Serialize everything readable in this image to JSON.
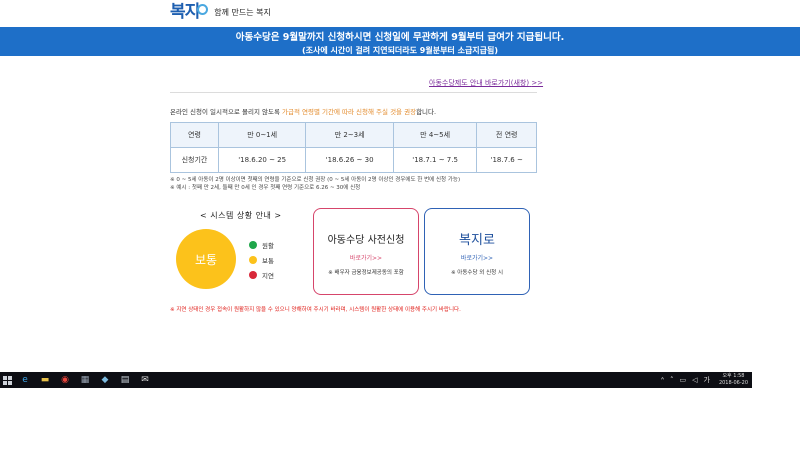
{
  "header": {
    "logo_text": "복지",
    "tagline": "함께 만드는 복지"
  },
  "banner": {
    "line1": "아동수당은 9월말까지 신청하시면 신청일에 무관하게 9월부터 급여가 지급됩니다.",
    "line2": "(조사에 시간이 걸려 지연되더라도 9월분부터 소급지급됨)"
  },
  "info_link": {
    "label": "아동수당제도 안내 바로가기(새창)",
    "arrow": ">>"
  },
  "intro": {
    "before": "온라인 신청이 일시적으로 몰리지 않도록 ",
    "highlight": "가급적 연령별 기간에 따라 신청해 주실 것을 권장",
    "after": "합니다."
  },
  "schedule": {
    "headers": [
      "연령",
      "만 0~1세",
      "만 2~3세",
      "만 4~5세",
      "전 연령"
    ],
    "row": [
      "신청기간",
      "'18.6.20 ~ 25",
      "'18.6.26 ~ 30",
      "'18.7.1 ~ 7.5",
      "'18.7.6 ~"
    ]
  },
  "notes": {
    "line1": "※ 0 ~ 5세 아동이 2명 이상이면 첫째의 연령을 기준으로 신청 권장 (0 ~ 5세 아동이 2명 이상인 경우에도 한 번에 신청 가능)",
    "line2": "※ 예시 : 첫째 만 2세, 둘째 만 0세 인 경우 첫째 연령 기준으로 6.26 ~ 30에 신청"
  },
  "status": {
    "title": "< 시스템 상황 안내 >",
    "current": "보통",
    "legend": [
      {
        "label": "원활",
        "color": "#1fa64a"
      },
      {
        "label": "보통",
        "color": "#fcc21b"
      },
      {
        "label": "지연",
        "color": "#d8283a"
      }
    ]
  },
  "cards": {
    "apply": {
      "title": "아동수당 사전신청",
      "go": "바로가기>>",
      "note": "※ 배우자 금융정보제공동의 포함"
    },
    "bokjiro": {
      "title": "복지로",
      "go": "바로가기>>",
      "note": "※ 아동수당 외 신청 시"
    }
  },
  "warning": "※ 지연 상태인 경우 접속이 원활하지 않을 수 있으니 양해하여 주시기 바라며, 시스템이 원활한 상태에 이용해 주시기 바랍니다.",
  "taskbar": {
    "apps": [
      {
        "name": "ie-icon",
        "glyph": "e",
        "color": "#3ea7ea"
      },
      {
        "name": "folder-icon",
        "glyph": "▬",
        "color": "#e8c14a"
      },
      {
        "name": "chrome-icon",
        "glyph": "◉",
        "color": "#e8453c"
      },
      {
        "name": "calculator-icon",
        "glyph": "▦",
        "color": "#9aa5b5"
      },
      {
        "name": "app-icon",
        "glyph": "◆",
        "color": "#7dbbe0"
      },
      {
        "name": "notepad-icon",
        "glyph": "▤",
        "color": "#cfd8e0"
      },
      {
        "name": "mail-icon",
        "glyph": "✉",
        "color": "#dcdcdc"
      }
    ],
    "clock_time": "오후 1:58",
    "clock_date": "2018-06-20"
  }
}
